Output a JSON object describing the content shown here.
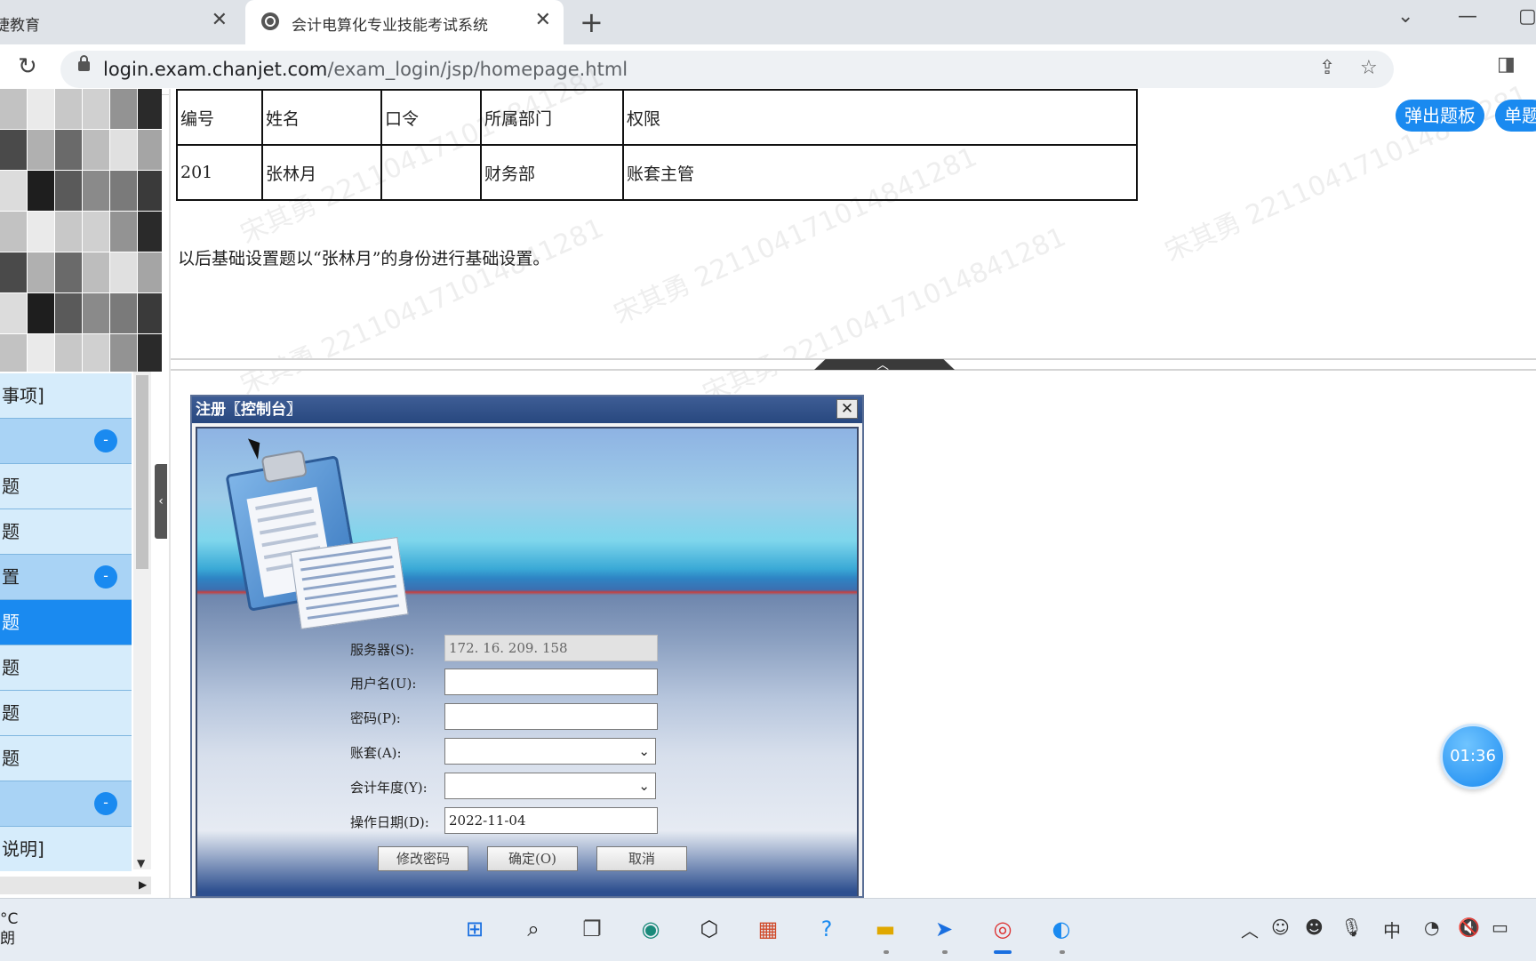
{
  "browser": {
    "tabs": [
      {
        "title": "捷教育",
        "active": false
      },
      {
        "title": "会计电算化专业技能考试系统",
        "active": true
      }
    ],
    "url_host": "login.exam.chanjet.com",
    "url_path": "/exam_login/jsp/homepage.html"
  },
  "sidebar": {
    "items": [
      {
        "label": "事项]",
        "kind": "item"
      },
      {
        "label": "",
        "kind": "group",
        "toggle": "-"
      },
      {
        "label": "题",
        "kind": "item"
      },
      {
        "label": "题",
        "kind": "item"
      },
      {
        "label": "置",
        "kind": "group",
        "toggle": "-"
      },
      {
        "label": "题",
        "kind": "selected"
      },
      {
        "label": "题",
        "kind": "item"
      },
      {
        "label": "题",
        "kind": "item"
      },
      {
        "label": "题",
        "kind": "item"
      },
      {
        "label": "",
        "kind": "group",
        "toggle": "-"
      },
      {
        "label": "说明]",
        "kind": "item"
      }
    ],
    "collapse_glyph": "‹"
  },
  "question": {
    "table_headers": [
      "编号",
      "姓名",
      "口令",
      "所属部门",
      "权限"
    ],
    "table_row": [
      "201",
      "张林月",
      "",
      "财务部",
      "账套主管"
    ],
    "instruction": "以后基础设置题以“张林月”的身份进行基础设置。",
    "watermark": "宋其勇 221104171014841281",
    "buttons": [
      "弹出题板",
      "单题"
    ]
  },
  "dialog": {
    "title": "注册〖控制台〗",
    "close": "✕",
    "fields": [
      {
        "label": "服务器(S):",
        "value": "172. 16. 209. 158",
        "type": "text",
        "disabled": true
      },
      {
        "label": "用户名(U):",
        "value": "",
        "type": "text",
        "disabled": false
      },
      {
        "label": "密码(P):",
        "value": "",
        "type": "password",
        "disabled": false
      },
      {
        "label": "账套(A):",
        "value": "",
        "type": "select",
        "disabled": false
      },
      {
        "label": "会计年度(Y):",
        "value": "",
        "type": "select",
        "disabled": false
      },
      {
        "label": "操作日期(D):",
        "value": "2022-11-04",
        "type": "text",
        "disabled": false
      }
    ],
    "buttons": [
      "修改密码",
      "确定(O)",
      "取消"
    ]
  },
  "timer": "01:36",
  "taskbar": {
    "weather_temp": "°C",
    "weather_desc": "朗",
    "ime": "中"
  }
}
